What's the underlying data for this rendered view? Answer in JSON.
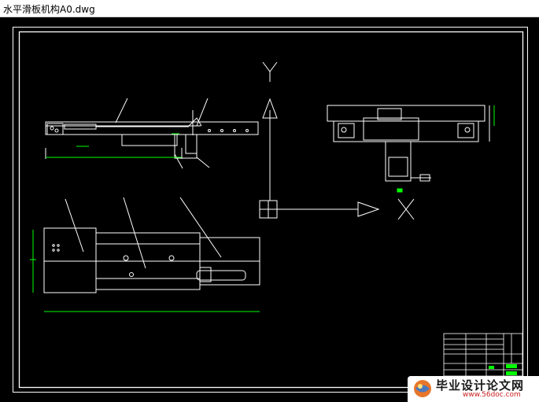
{
  "window": {
    "title": "水平滑板机构A0.dwg"
  },
  "drawing": {
    "background_color": "#000000",
    "line_color": "#ffffff",
    "dimension_color": "#00ff00"
  },
  "watermark": {
    "title": "毕业设计论文网",
    "url": "www.56doc.com"
  }
}
